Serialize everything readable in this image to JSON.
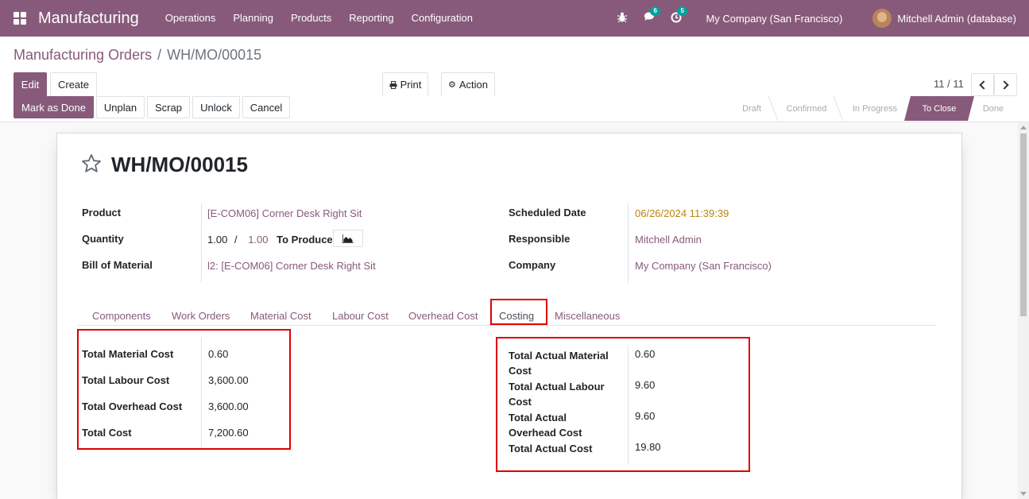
{
  "nav": {
    "brand": "Manufacturing",
    "menu": [
      "Operations",
      "Planning",
      "Products",
      "Reporting",
      "Configuration"
    ],
    "chat_badge": "6",
    "activity_badge": "5",
    "company": "My Company (San Francisco)",
    "user": "Mitchell Admin (database)",
    "accent_color": "#875a7b"
  },
  "breadcrumb": {
    "parent": "Manufacturing Orders",
    "separator": "/",
    "current": "WH/MO/00015"
  },
  "buttons": {
    "edit": "Edit",
    "create": "Create",
    "print": "Print",
    "action": "Action"
  },
  "pager": {
    "value": "11 / 11"
  },
  "statusbar": {
    "actions": [
      "Mark as Done",
      "Unplan",
      "Scrap",
      "Unlock",
      "Cancel"
    ],
    "stages": [
      "Draft",
      "Confirmed",
      "In Progress",
      "To Close",
      "Done"
    ],
    "active_stage": "To Close"
  },
  "record": {
    "title": "WH/MO/00015",
    "product_label": "Product",
    "product": "[E-COM06] Corner Desk Right Sit",
    "quantity_label": "Quantity",
    "qty_produced": "1.00",
    "qty_sep": "/",
    "qty_total": "1.00",
    "to_produce": "To Produce",
    "bom_label": "Bill of Material",
    "bom": "l2: [E-COM06] Corner Desk Right Sit",
    "scheduled_label": "Scheduled Date",
    "scheduled": "06/26/2024 11:39:39",
    "responsible_label": "Responsible",
    "responsible": "Mitchell Admin",
    "company_label": "Company",
    "company": "My Company (San Francisco)"
  },
  "tabs": [
    "Components",
    "Work Orders",
    "Material Cost",
    "Labour Cost",
    "Overhead Cost",
    "Costing",
    "Miscellaneous"
  ],
  "active_tab": "Costing",
  "costing": {
    "left": [
      {
        "label": "Total Material Cost",
        "value": "0.60"
      },
      {
        "label": "Total Labour Cost",
        "value": "3,600.00"
      },
      {
        "label": "Total Overhead Cost",
        "value": "3,600.00"
      },
      {
        "label": "Total Cost",
        "value": "7,200.60"
      }
    ],
    "right": [
      {
        "label1": "Total Actual Material",
        "label2": "Cost",
        "value": "0.60"
      },
      {
        "label1": "Total Actual Labour",
        "label2": "Cost",
        "value": "9.60"
      },
      {
        "label1": "Total Actual",
        "label2": "Overhead Cost",
        "value": "9.60"
      },
      {
        "label1": "Total Actual Cost",
        "label2": "",
        "value": "19.80"
      }
    ]
  }
}
